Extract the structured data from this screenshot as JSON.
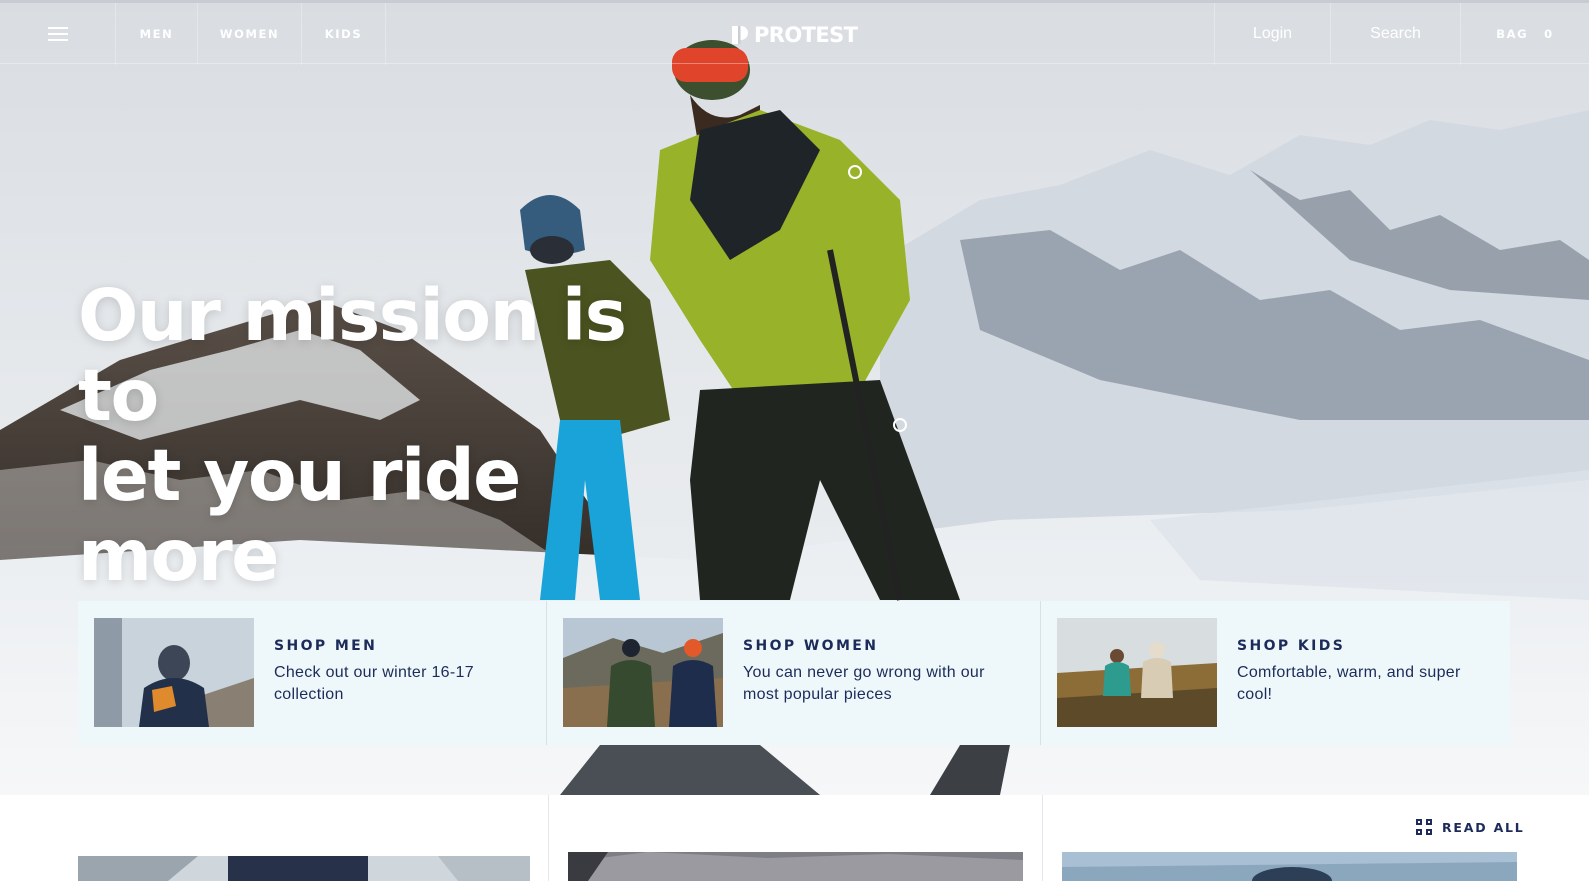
{
  "nav": {
    "menu_icon": "hamburger-menu-icon",
    "links": [
      "MEN",
      "WOMEN",
      "KIDS"
    ],
    "logo_text": "PROTEST",
    "login": "Login",
    "search": "Search",
    "bag_label": "BAG",
    "bag_count": "0"
  },
  "hero": {
    "headline_line1": "Our mission is to",
    "headline_line2": "let you ride more"
  },
  "shop": [
    {
      "title": "SHOP MEN",
      "description": "Check out our winter 16-17 collection"
    },
    {
      "title": "SHOP WOMEN",
      "description": "You can never go wrong with our most popular pieces"
    },
    {
      "title": "SHOP KIDS",
      "description": "Comfortable, warm, and super cool!"
    }
  ],
  "blog": {
    "read_all_label": "READ ALL",
    "read_all_icon": "grid-icon"
  },
  "colors": {
    "navy": "#1c2b5a",
    "card_bg": "#eef8fa",
    "white": "#ffffff"
  }
}
